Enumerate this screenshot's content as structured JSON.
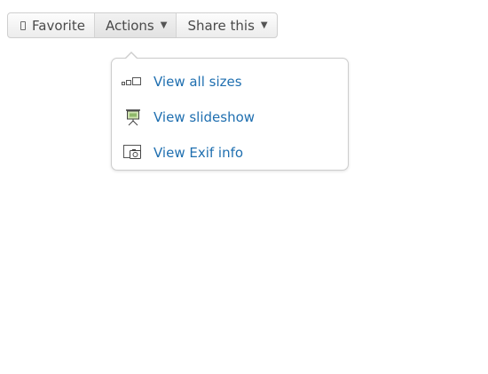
{
  "toolbar": {
    "favorite_label": "Favorite",
    "actions_label": "Actions",
    "share_label": "Share this",
    "caret": "▼"
  },
  "actions_menu": {
    "items": [
      {
        "label": "View all sizes",
        "icon": "all-sizes-icon"
      },
      {
        "label": "View slideshow",
        "icon": "slideshow-icon"
      },
      {
        "label": "View Exif info",
        "icon": "exif-camera-icon"
      }
    ]
  },
  "colors": {
    "link": "#1f6fb0",
    "button_text": "#4a4a4a",
    "border": "#cfcfcf"
  }
}
